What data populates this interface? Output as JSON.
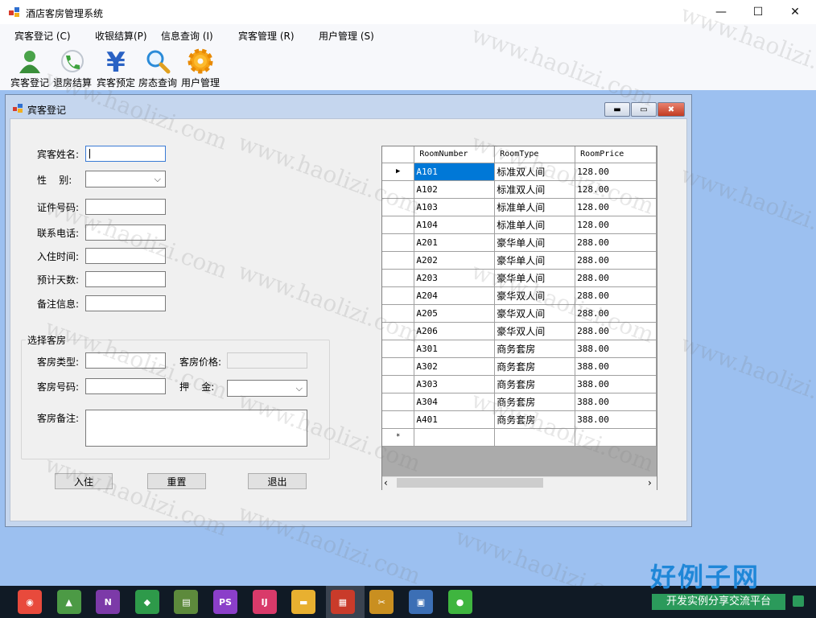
{
  "window": {
    "title": "酒店客房管理系统",
    "minimize": "—",
    "maximize": "☐",
    "close": "✕"
  },
  "menu": [
    {
      "label": "宾客登记 (C)"
    },
    {
      "label": "收银结算(P)"
    },
    {
      "label": "信息查询 (I)"
    },
    {
      "label": "宾客管理 (R)"
    },
    {
      "label": "用户管理 (S)"
    }
  ],
  "toolbar": [
    {
      "label": "宾客登记",
      "icon": "user-icon"
    },
    {
      "label": "退房结算",
      "icon": "phone-icon"
    },
    {
      "label": "宾客预定",
      "icon": "yen-icon"
    },
    {
      "label": "房态查询",
      "icon": "magnifier-icon"
    },
    {
      "label": "用户管理",
      "icon": "gear-icon"
    }
  ],
  "form": {
    "title": "宾客登记",
    "fields": {
      "name_label": "宾客姓名:",
      "gender_label": "性    别:",
      "id_label": "证件号码:",
      "phone_label": "联系电话:",
      "checkin_label": "入住时间:",
      "days_label": "预计天数:",
      "note_label": "备注信息:"
    },
    "room_group": {
      "title": "选择客房",
      "type_label": "客房类型:",
      "price_label": "客房价格:",
      "number_label": "客房号码:",
      "deposit_label": "押    金:",
      "remark_label": "客房备注:"
    },
    "buttons": {
      "checkin": "入住",
      "reset": "重置",
      "exit": "退出"
    }
  },
  "grid": {
    "columns": [
      "RoomNumber",
      "RoomType",
      "RoomPrice"
    ],
    "rows": [
      [
        "A101",
        "标准双人间",
        "128.00"
      ],
      [
        "A102",
        "标准双人间",
        "128.00"
      ],
      [
        "A103",
        "标准单人间",
        "128.00"
      ],
      [
        "A104",
        "标准单人间",
        "128.00"
      ],
      [
        "A201",
        "豪华单人间",
        "288.00"
      ],
      [
        "A202",
        "豪华单人间",
        "288.00"
      ],
      [
        "A203",
        "豪华单人间",
        "288.00"
      ],
      [
        "A204",
        "豪华双人间",
        "288.00"
      ],
      [
        "A205",
        "豪华双人间",
        "288.00"
      ],
      [
        "A206",
        "豪华双人间",
        "288.00"
      ],
      [
        "A301",
        "商务套房",
        "388.00"
      ],
      [
        "A302",
        "商务套房",
        "388.00"
      ],
      [
        "A303",
        "商务套房",
        "388.00"
      ],
      [
        "A304",
        "商务套房",
        "388.00"
      ],
      [
        "A401",
        "商务套房",
        "388.00"
      ]
    ],
    "new_row_marker": "*",
    "current_row_marker": "▶"
  },
  "watermark": "www.haolizi.com",
  "brand": {
    "name": "好例子网",
    "tagline": "开发实例分享交流平台"
  },
  "taskbar": [
    "chrome-icon",
    "android-studio-icon",
    "onenote-icon",
    "evernote-icon",
    "notepad-icon",
    "phpstorm-icon",
    "intellij-icon",
    "file-explorer-icon",
    "app-icon",
    "tools-icon",
    "screenshot-icon",
    "wechat-icon"
  ]
}
